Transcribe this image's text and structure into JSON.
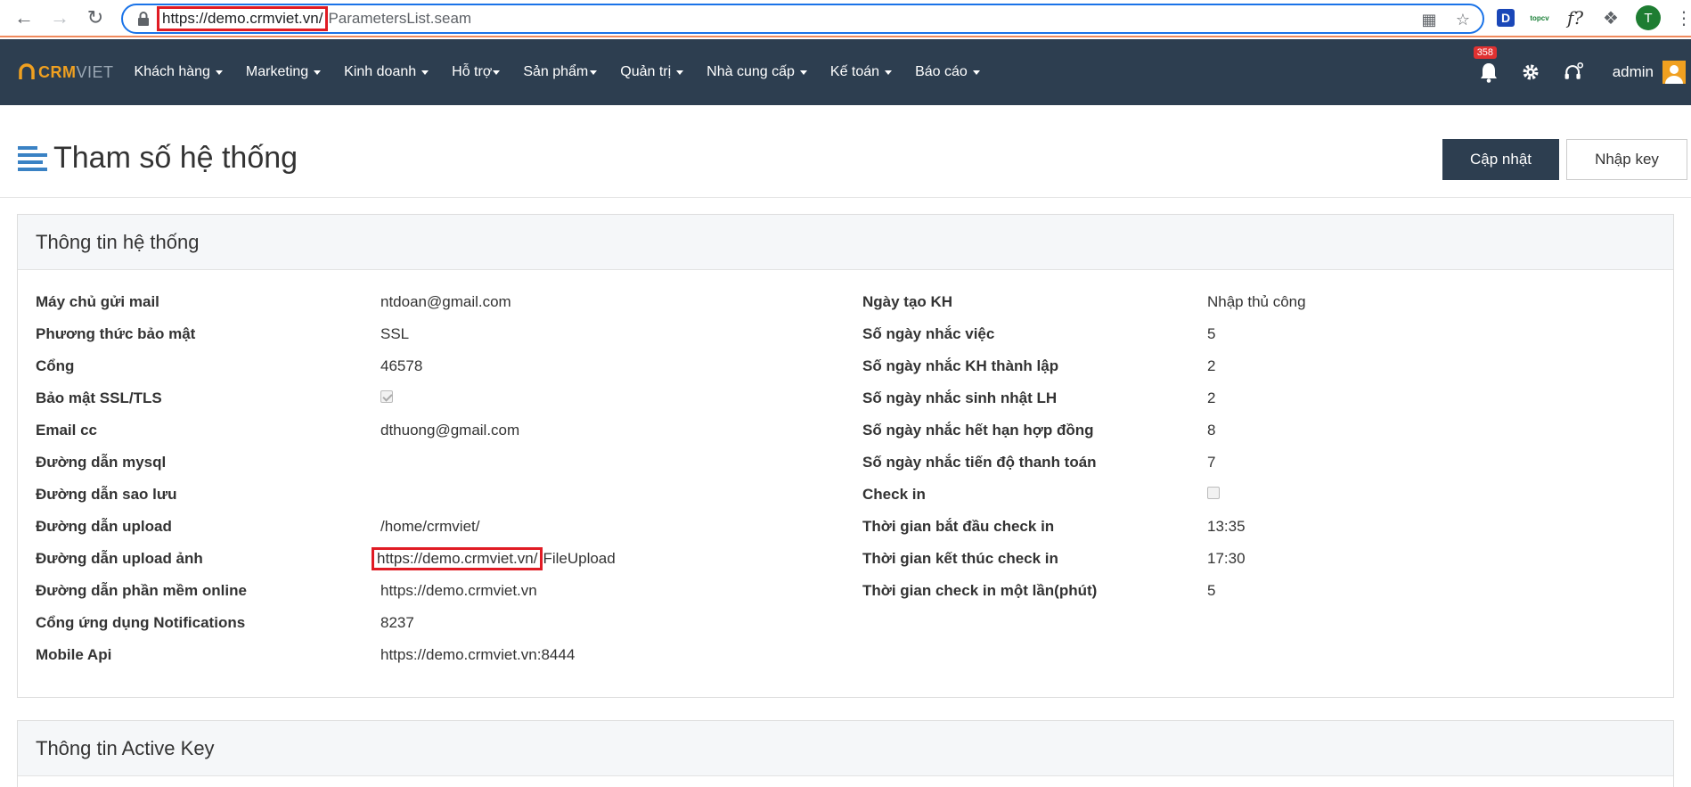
{
  "browser": {
    "url_host": "https://demo.crmviet.vn/",
    "url_path": "ParametersList.seam",
    "profile_initial": "T",
    "ext_topcv": "topcv",
    "ext_d": "D",
    "ext_f": "f?"
  },
  "nav": {
    "logo_crm": "CRM",
    "logo_viet": "VIET",
    "menu": [
      {
        "label": "Khách hàng"
      },
      {
        "label": "Marketing"
      },
      {
        "label": "Kinh doanh"
      },
      {
        "label": "Hỗ trợ"
      },
      {
        "label": "Sản phẩm"
      },
      {
        "label": "Quản trị"
      },
      {
        "label": "Nhà cung cấp"
      },
      {
        "label": "Kế toán"
      },
      {
        "label": "Báo cáo"
      }
    ],
    "notification_count": "358",
    "user_name": "admin"
  },
  "page": {
    "title": "Tham số hệ thống",
    "update_button": "Cập nhật",
    "key_button": "Nhập key"
  },
  "system_info": {
    "heading": "Thông tin hệ thống",
    "left": [
      {
        "label": "Máy chủ gửi mail",
        "value": "ntdoan@gmail.com"
      },
      {
        "label": "Phương thức bảo mật",
        "value": "SSL"
      },
      {
        "label": "Cổng",
        "value": "46578"
      },
      {
        "label": "Bảo mật SSL/TLS",
        "checked": true
      },
      {
        "label": "Email cc",
        "value": "dthuong@gmail.com"
      },
      {
        "label": "Đường dẫn mysql",
        "value": ""
      },
      {
        "label": "Đường dẫn sao lưu",
        "value": ""
      },
      {
        "label": "Đường dẫn upload",
        "value": "/home/crmviet/"
      },
      {
        "label": "Đường dẫn upload ảnh",
        "value_host": "https://demo.crmviet.vn/",
        "value_path": "FileUpload"
      },
      {
        "label": "Đường dẫn phần mềm online",
        "value": "https://demo.crmviet.vn"
      },
      {
        "label": "Cổng ứng dụng Notifications",
        "value": "8237"
      },
      {
        "label": "Mobile Api",
        "value": "https://demo.crmviet.vn:8444"
      }
    ],
    "right": [
      {
        "label": "Ngày tạo KH",
        "value": "Nhập thủ công"
      },
      {
        "label": "Số ngày nhắc việc",
        "value": "5"
      },
      {
        "label": "Số ngày nhắc KH thành lập",
        "value": "2"
      },
      {
        "label": "Số ngày nhắc sinh nhật LH",
        "value": "2"
      },
      {
        "label": "Số ngày nhắc hết hạn hợp đồng",
        "value": "8"
      },
      {
        "label": "Số ngày nhắc tiến độ thanh toán",
        "value": "7"
      },
      {
        "label": "Check in",
        "checked": false
      },
      {
        "label": "Thời gian bắt đầu check in",
        "value": "13:35"
      },
      {
        "label": "Thời gian kết thúc check in",
        "value": "17:30"
      },
      {
        "label": "Thời gian check in một lần(phút)",
        "value": "5"
      }
    ]
  },
  "active_key": {
    "heading": "Thông tin Active Key"
  }
}
